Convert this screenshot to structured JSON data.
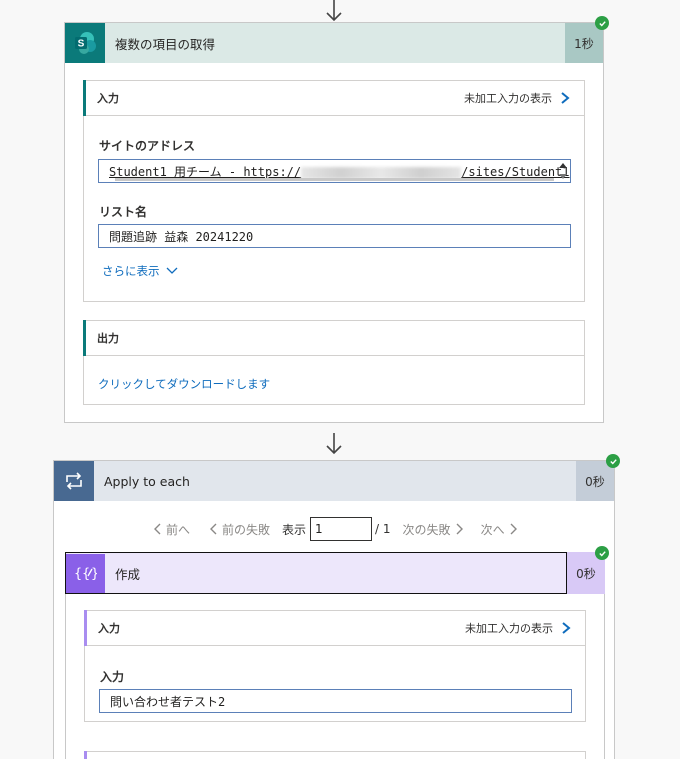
{
  "get_items": {
    "title": "複数の項目の取得",
    "duration": "1秒",
    "inputs": {
      "title": "入力",
      "raw_link": "未加工入力の表示",
      "site_label": "サイトのアドレス",
      "site_value_prefix": "Student1 用チーム - https://",
      "site_value_suffix": "/sites/Student1",
      "list_label": "リスト名",
      "list_value": "問題追跡 益森 20241220",
      "show_more": "さらに表示"
    },
    "outputs": {
      "title": "出力",
      "download_link": "クリックしてダウンロードします"
    }
  },
  "apply_each": {
    "title": "Apply to each",
    "duration": "0秒",
    "pager": {
      "prev": "前へ",
      "prev_fail": "前の失敗",
      "show": "表示",
      "current": "1",
      "total": "/ 1",
      "next_fail": "次の失敗",
      "next": "次へ"
    }
  },
  "compose": {
    "title": "作成",
    "duration": "0秒",
    "inputs": {
      "title": "入力",
      "raw_link": "未加工入力の表示",
      "input_label": "入力",
      "input_value": "問い合わせ者テスト2"
    }
  },
  "colors": {
    "sharepoint_header": "#dbe9e6",
    "sharepoint_time": "#a9c8c4",
    "sharepoint_icon": "#0b7a7a",
    "loop_header": "#e1e6ec",
    "loop_icon": "#486991",
    "loop_time": "#c4cdd8",
    "compose_header": "#ede7fb",
    "compose_icon": "#8a60e8",
    "compose_time": "#d8c9f6",
    "success": "#2c9f45"
  },
  "icons": {
    "sharepoint": "sharepoint-icon",
    "loop": "loop-icon",
    "compose": "compose-icon"
  }
}
